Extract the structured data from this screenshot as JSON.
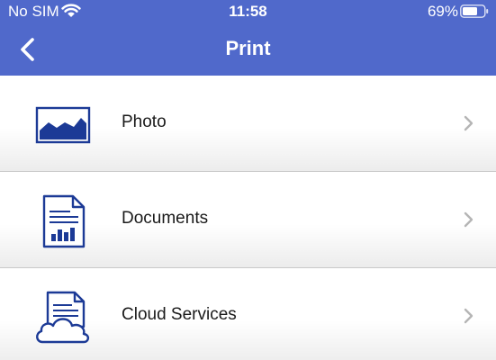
{
  "status_bar": {
    "carrier": "No SIM",
    "time": "11:58",
    "battery_percent": "69%",
    "icons": [
      "wifi-icon",
      "battery-icon"
    ]
  },
  "nav": {
    "title": "Print",
    "back_icon": "chevron-left-icon"
  },
  "menu": {
    "items": [
      {
        "label": "Photo",
        "icon": "photo-icon"
      },
      {
        "label": "Documents",
        "icon": "document-icon"
      },
      {
        "label": "Cloud Services",
        "icon": "cloud-services-icon"
      }
    ]
  },
  "colors": {
    "header_bg": "#5069cb",
    "icon_blue": "#1c3a96",
    "chevron_gray": "#b5b5b5"
  }
}
